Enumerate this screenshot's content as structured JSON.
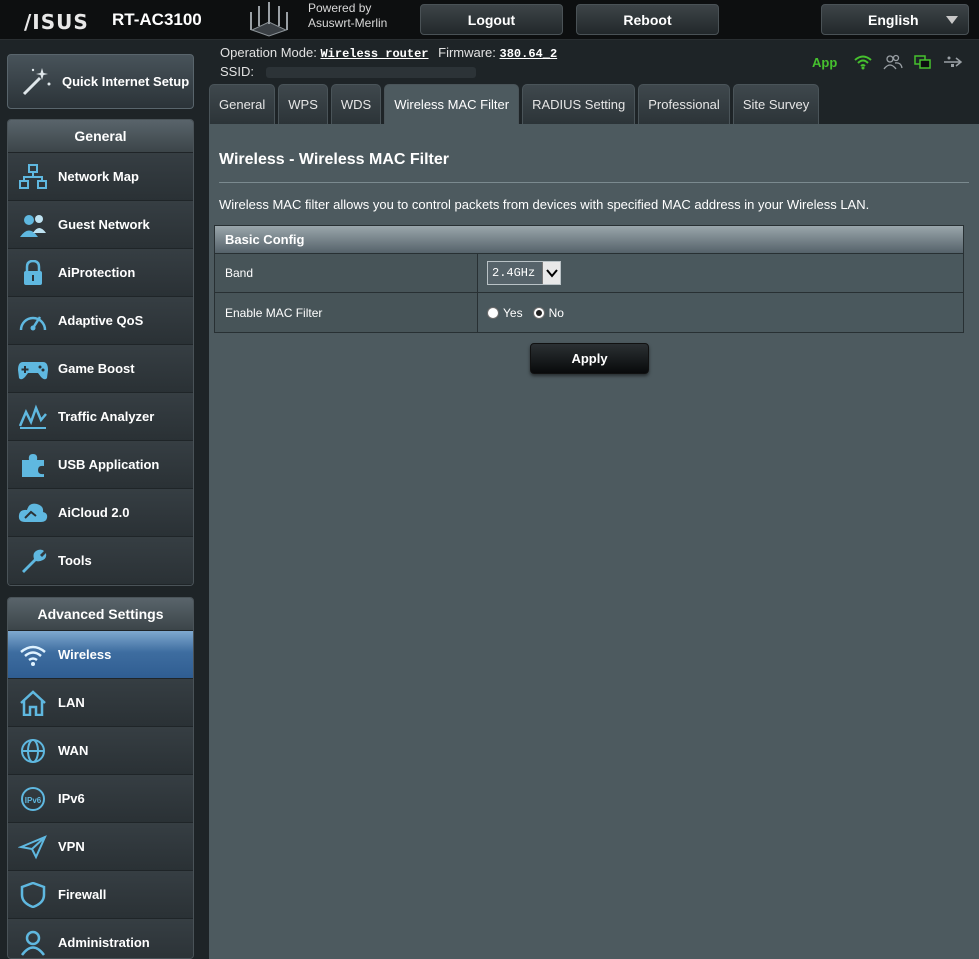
{
  "header": {
    "brand": "/ISUS",
    "model": "RT-AC3100",
    "powered_by_line1": "Powered by",
    "powered_by_line2": "Asuswrt-Merlin",
    "logout_label": "Logout",
    "reboot_label": "Reboot",
    "language_label": "English"
  },
  "status": {
    "operation_mode_label": "Operation Mode:",
    "operation_mode_value": "Wireless router",
    "firmware_label": "Firmware:",
    "firmware_value": "380.64_2",
    "ssid_label": "SSID:",
    "app_label": "App",
    "app_color": "#46c12e"
  },
  "sidebar": {
    "quick_setup": "Quick Internet Setup",
    "general_header": "General",
    "general_items": [
      {
        "label": "Network Map",
        "icon": "network-map-icon"
      },
      {
        "label": "Guest Network",
        "icon": "guest-network-icon"
      },
      {
        "label": "AiProtection",
        "icon": "lock-icon"
      },
      {
        "label": "Adaptive QoS",
        "icon": "gauge-icon"
      },
      {
        "label": "Game Boost",
        "icon": "gamepad-icon"
      },
      {
        "label": "Traffic Analyzer",
        "icon": "traffic-graph-icon"
      },
      {
        "label": "USB Application",
        "icon": "puzzle-icon"
      },
      {
        "label": "AiCloud 2.0",
        "icon": "cloud-icon"
      },
      {
        "label": "Tools",
        "icon": "wrench-icon"
      }
    ],
    "advanced_header": "Advanced Settings",
    "advanced_items": [
      {
        "label": "Wireless",
        "icon": "wifi-icon",
        "active": true
      },
      {
        "label": "LAN",
        "icon": "home-icon"
      },
      {
        "label": "WAN",
        "icon": "globe-icon"
      },
      {
        "label": "IPv6",
        "icon": "ipv6-icon"
      },
      {
        "label": "VPN",
        "icon": "vpn-icon"
      },
      {
        "label": "Firewall",
        "icon": "shield-icon"
      },
      {
        "label": "Administration",
        "icon": "admin-user-icon"
      }
    ]
  },
  "tabs": [
    "General",
    "WPS",
    "WDS",
    "Wireless MAC Filter",
    "RADIUS Setting",
    "Professional",
    "Site Survey"
  ],
  "active_tab": "Wireless MAC Filter",
  "main": {
    "title": "Wireless - Wireless MAC Filter",
    "description": "Wireless MAC filter allows you to control packets from devices with specified MAC address in your Wireless LAN.",
    "section_title": "Basic Config",
    "band_label": "Band",
    "band_value": "2.4GHz",
    "mac_filter_label": "Enable MAC Filter",
    "yes_label": "Yes",
    "no_label": "No",
    "mac_filter_selected": "No",
    "apply_label": "Apply"
  },
  "colors": {
    "panel_bg": "#4d5a5f",
    "active_menu": "#3e6da0",
    "accent_icon": "#5fb8e0"
  }
}
